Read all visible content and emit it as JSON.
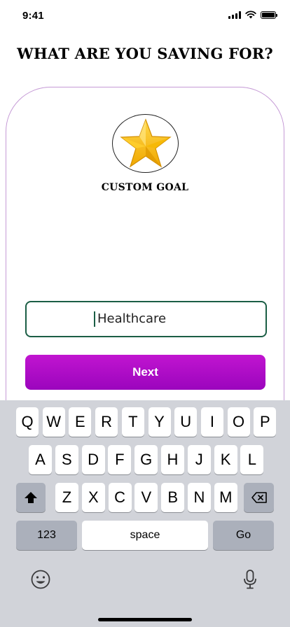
{
  "status_bar": {
    "time": "9:41"
  },
  "page": {
    "title": "WHAT ARE YOU SAVING FOR?"
  },
  "goal": {
    "label": "CUSTOM GOAL",
    "icon": "star-icon"
  },
  "form": {
    "input_value": "Healthcare",
    "next_label": "Next"
  },
  "keyboard": {
    "row1": [
      "Q",
      "W",
      "E",
      "R",
      "T",
      "Y",
      "U",
      "I",
      "O",
      "P"
    ],
    "row2": [
      "A",
      "S",
      "D",
      "F",
      "G",
      "H",
      "J",
      "K",
      "L"
    ],
    "row3": [
      "Z",
      "X",
      "C",
      "V",
      "B",
      "N",
      "M"
    ],
    "numbers_label": "123",
    "space_label": "space",
    "go_label": "Go"
  },
  "colors": {
    "accent": "#a50dc2",
    "input_border": "#1b5e45",
    "card_border": "#c59ad6"
  }
}
